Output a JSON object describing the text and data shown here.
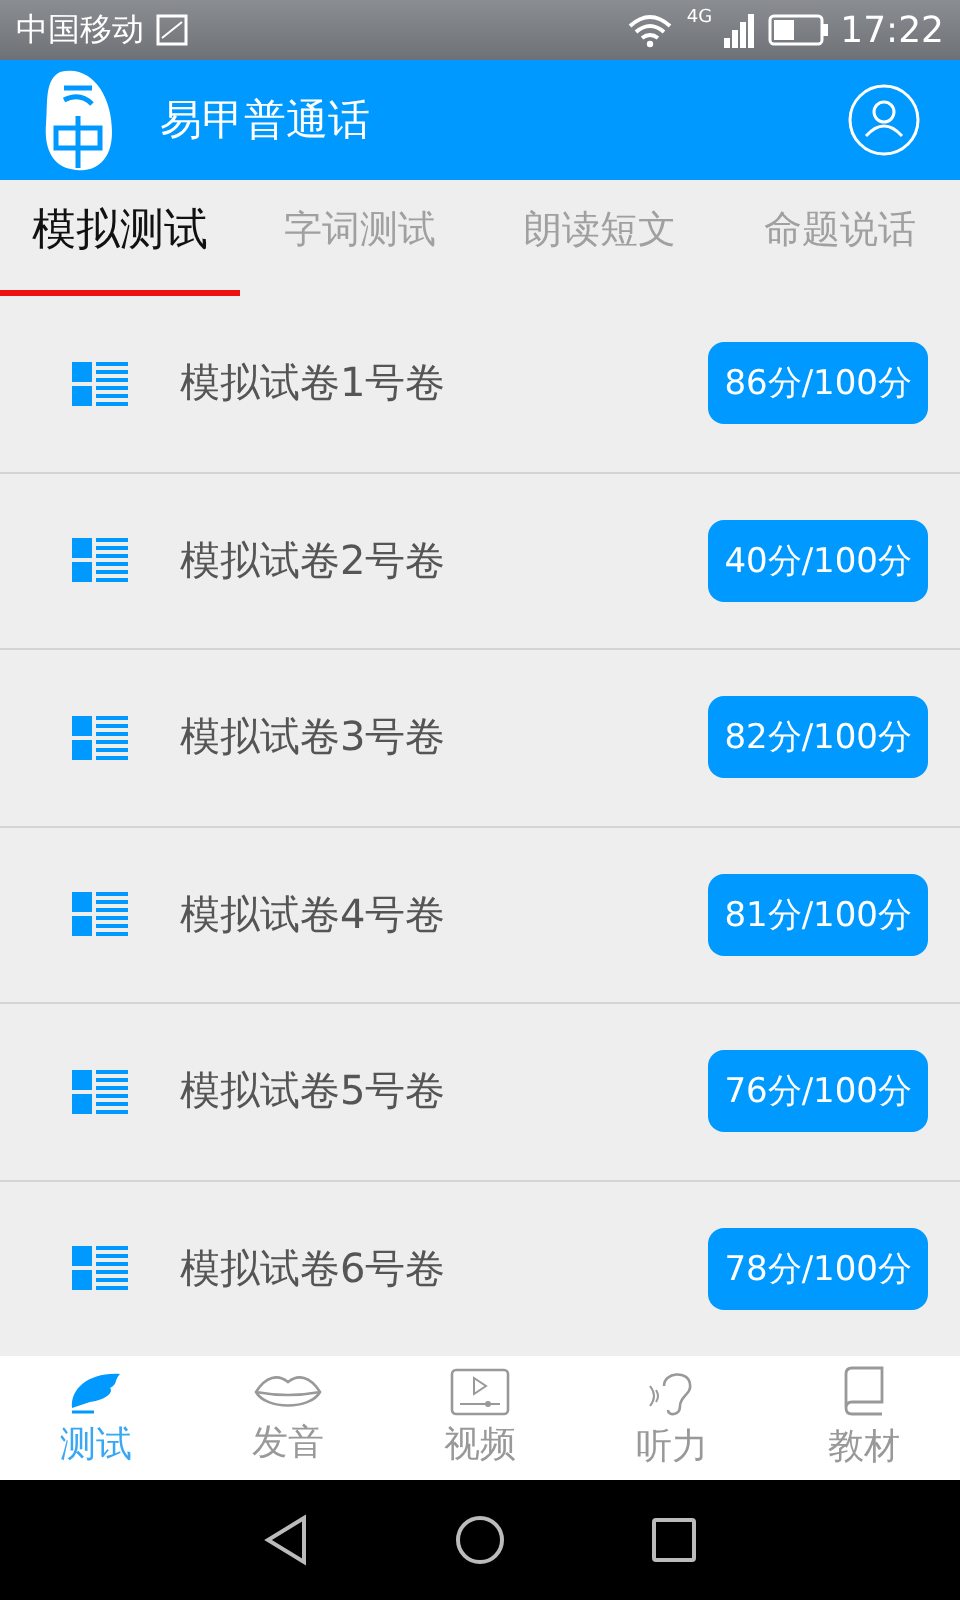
{
  "status_bar": {
    "carrier": "中国移动",
    "network": "4G",
    "time": "17:22"
  },
  "app_bar": {
    "title": "易甲普通话"
  },
  "tabs": [
    {
      "label": "模拟测试",
      "selected": true
    },
    {
      "label": "字词测试",
      "selected": false
    },
    {
      "label": "朗读短文",
      "selected": false
    },
    {
      "label": "命题说话",
      "selected": false
    }
  ],
  "tests": [
    {
      "title": "模拟试卷1号卷",
      "score": "86分/100分"
    },
    {
      "title": "模拟试卷2号卷",
      "score": "40分/100分"
    },
    {
      "title": "模拟试卷3号卷",
      "score": "82分/100分"
    },
    {
      "title": "模拟试卷4号卷",
      "score": "81分/100分"
    },
    {
      "title": "模拟试卷5号卷",
      "score": "76分/100分"
    },
    {
      "title": "模拟试卷6号卷",
      "score": "78分/100分"
    }
  ],
  "bottom_nav": [
    {
      "kind": "feather",
      "label": "测试",
      "selected": true
    },
    {
      "kind": "lips",
      "label": "发音",
      "selected": false
    },
    {
      "kind": "video",
      "label": "视频",
      "selected": false
    },
    {
      "kind": "ear",
      "label": "听力",
      "selected": false
    },
    {
      "kind": "book",
      "label": "教材",
      "selected": false
    }
  ]
}
